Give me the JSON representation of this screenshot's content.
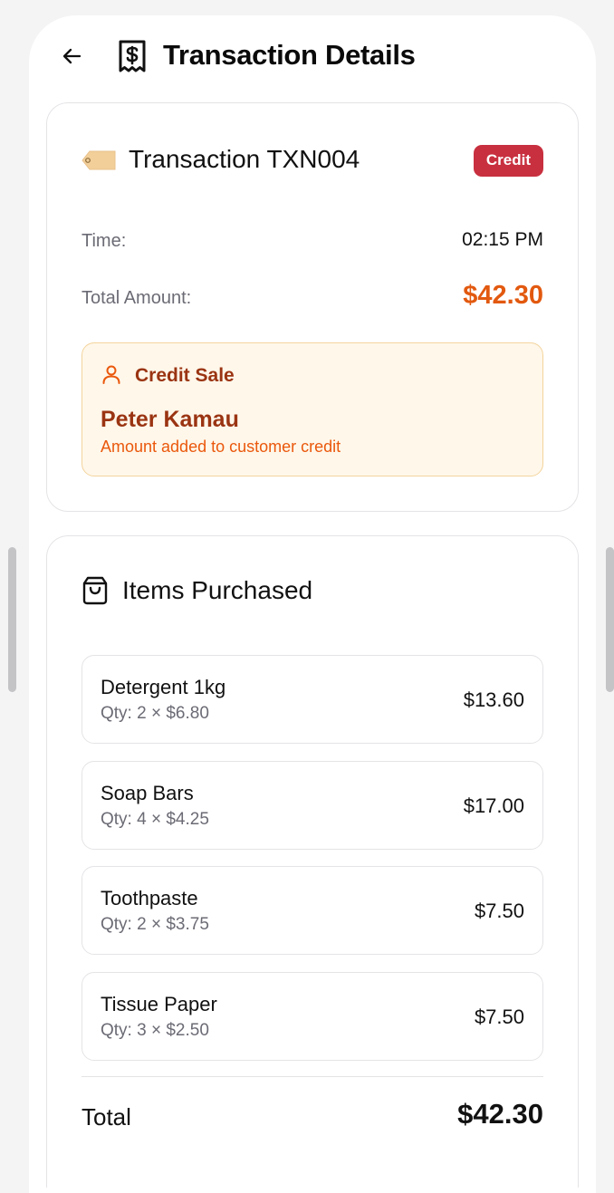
{
  "header": {
    "title": "Transaction Details",
    "back_icon": "arrow-left-icon",
    "title_icon": "receipt-dollar-icon"
  },
  "summary": {
    "transaction_title": "Transaction TXN004",
    "tag_icon": "tag-icon",
    "status_badge": "Credit",
    "time_label": "Time:",
    "time_value": "02:15 PM",
    "amount_label": "Total Amount:",
    "amount_value": "$42.30",
    "credit_sale": {
      "icon": "user-icon",
      "heading": "Credit Sale",
      "customer_name": "Peter Kamau",
      "note": "Amount added to customer credit"
    }
  },
  "items_section": {
    "title": "Items Purchased",
    "icon": "shopping-bag-icon",
    "items": [
      {
        "name": "Detergent 1kg",
        "qty": "Qty: 2 × $6.80",
        "total": "$13.60"
      },
      {
        "name": "Soap Bars",
        "qty": "Qty: 4 × $4.25",
        "total": "$17.00"
      },
      {
        "name": "Toothpaste",
        "qty": "Qty: 2 × $3.75",
        "total": "$7.50"
      },
      {
        "name": "Tissue Paper",
        "qty": "Qty: 3 × $2.50",
        "total": "$7.50"
      }
    ],
    "total_label": "Total",
    "total_value": "$42.30"
  },
  "colors": {
    "accent_orange": "#e2590f",
    "badge_red": "#c8303f",
    "credit_box_bg": "#fff7ea",
    "credit_text": "#9a3412"
  }
}
